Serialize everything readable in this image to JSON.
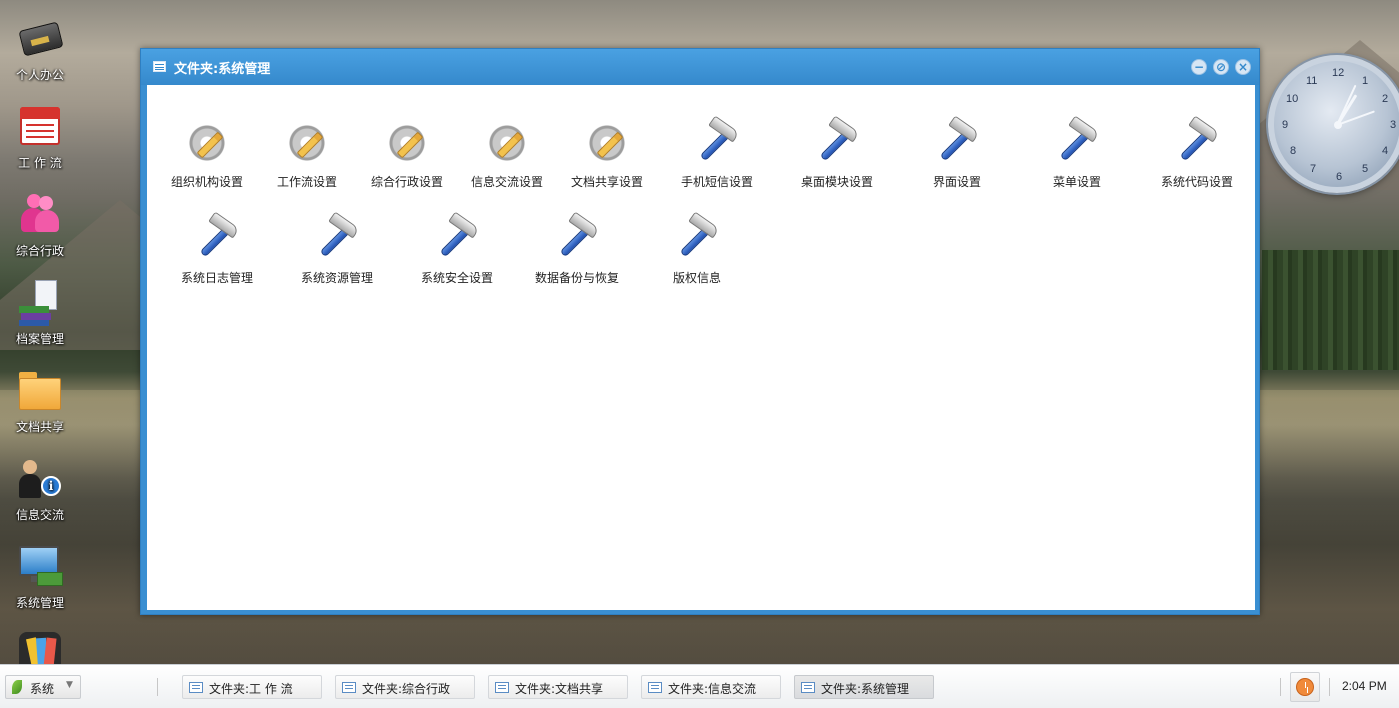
{
  "desktop": {
    "icons": [
      {
        "label": "个人办公",
        "icon": "briefcase-icon"
      },
      {
        "label": "工 作 流",
        "icon": "calendar-icon"
      },
      {
        "label": "综合行政",
        "icon": "people-icon"
      },
      {
        "label": "档案管理",
        "icon": "books-icon"
      },
      {
        "label": "文档共享",
        "icon": "folder-icon"
      },
      {
        "label": "信息交流",
        "icon": "info-people-icon"
      },
      {
        "label": "系统管理",
        "icon": "computer-icon"
      }
    ]
  },
  "clock": {
    "numbers": [
      "12",
      "1",
      "2",
      "3",
      "4",
      "5",
      "6",
      "7",
      "8",
      "9",
      "10",
      "11"
    ]
  },
  "window": {
    "title": "文件夹:系统管理",
    "controls": {
      "minimize": "minimize-icon",
      "maximize": "maximize-icon",
      "close": "close-icon"
    },
    "items": [
      {
        "label": "组织机构设置",
        "icon": "gear-icon"
      },
      {
        "label": "工作流设置",
        "icon": "gear-icon"
      },
      {
        "label": "综合行政设置",
        "icon": "gear-icon"
      },
      {
        "label": "信息交流设置",
        "icon": "gear-icon"
      },
      {
        "label": "文档共享设置",
        "icon": "gear-icon"
      },
      {
        "label": "手机短信设置",
        "icon": "hammer-icon"
      },
      {
        "label": "桌面模块设置",
        "icon": "hammer-icon"
      },
      {
        "label": "界面设置",
        "icon": "hammer-icon"
      },
      {
        "label": "菜单设置",
        "icon": "hammer-icon"
      },
      {
        "label": "系统代码设置",
        "icon": "hammer-icon"
      },
      {
        "label": "系统日志管理",
        "icon": "hammer-icon"
      },
      {
        "label": "系统资源管理",
        "icon": "hammer-icon"
      },
      {
        "label": "系统安全设置",
        "icon": "hammer-icon"
      },
      {
        "label": "数据备份与恢复",
        "icon": "hammer-icon"
      },
      {
        "label": "版权信息",
        "icon": "hammer-icon"
      }
    ]
  },
  "taskbar": {
    "start_label": "系统",
    "tasks": [
      {
        "label": "文件夹:工 作 流",
        "active": false
      },
      {
        "label": "文件夹:综合行政",
        "active": false
      },
      {
        "label": "文件夹:文档共享",
        "active": false
      },
      {
        "label": "文件夹:信息交流",
        "active": false
      },
      {
        "label": "文件夹:系统管理",
        "active": true
      }
    ],
    "time": "2:04 PM"
  }
}
